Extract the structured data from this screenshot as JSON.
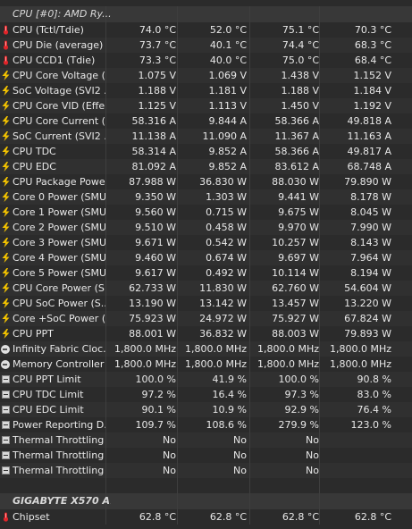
{
  "groups": [
    {
      "title": "CPU [#0]: AMD Ry...",
      "rows": [
        {
          "icon": "thermometer-icon",
          "name": "CPU (Tctl/Tdie)",
          "v": [
            "74.0 °C",
            "52.0 °C",
            "75.1 °C",
            "70.3 °C"
          ]
        },
        {
          "icon": "thermometer-icon",
          "name": "CPU Die (average)",
          "v": [
            "73.7 °C",
            "40.1 °C",
            "74.4 °C",
            "68.3 °C"
          ]
        },
        {
          "icon": "thermometer-icon",
          "name": "CPU CCD1 (Tdie)",
          "v": [
            "73.3 °C",
            "40.0 °C",
            "75.0 °C",
            "68.4 °C"
          ]
        },
        {
          "icon": "lightning-icon",
          "name": "CPU Core Voltage (...",
          "v": [
            "1.075 V",
            "1.069 V",
            "1.438 V",
            "1.152 V"
          ]
        },
        {
          "icon": "lightning-icon",
          "name": "SoC Voltage (SVI2 ...",
          "v": [
            "1.188 V",
            "1.181 V",
            "1.188 V",
            "1.184 V"
          ]
        },
        {
          "icon": "lightning-icon",
          "name": "CPU Core VID (Effe...",
          "v": [
            "1.125 V",
            "1.113 V",
            "1.450 V",
            "1.192 V"
          ]
        },
        {
          "icon": "lightning-icon",
          "name": "CPU Core Current (...",
          "v": [
            "58.316 A",
            "9.844 A",
            "58.366 A",
            "49.818 A"
          ]
        },
        {
          "icon": "lightning-icon",
          "name": "SoC Current (SVI2 ...",
          "v": [
            "11.138 A",
            "11.090 A",
            "11.367 A",
            "11.163 A"
          ]
        },
        {
          "icon": "lightning-icon",
          "name": "CPU TDC",
          "v": [
            "58.314 A",
            "9.852 A",
            "58.366 A",
            "49.817 A"
          ]
        },
        {
          "icon": "lightning-icon",
          "name": "CPU EDC",
          "v": [
            "81.092 A",
            "9.852 A",
            "83.612 A",
            "68.748 A"
          ]
        },
        {
          "icon": "lightning-icon",
          "name": "CPU Package Powe...",
          "v": [
            "87.988 W",
            "36.830 W",
            "88.030 W",
            "79.890 W"
          ]
        },
        {
          "icon": "lightning-icon",
          "name": "Core 0 Power (SMU)",
          "v": [
            "9.350 W",
            "1.303 W",
            "9.441 W",
            "8.178 W"
          ]
        },
        {
          "icon": "lightning-icon",
          "name": "Core 1 Power (SMU)",
          "v": [
            "9.560 W",
            "0.715 W",
            "9.675 W",
            "8.045 W"
          ]
        },
        {
          "icon": "lightning-icon",
          "name": "Core 2 Power (SMU)",
          "v": [
            "9.510 W",
            "0.458 W",
            "9.970 W",
            "7.990 W"
          ]
        },
        {
          "icon": "lightning-icon",
          "name": "Core 3 Power (SMU)",
          "v": [
            "9.671 W",
            "0.542 W",
            "10.257 W",
            "8.143 W"
          ]
        },
        {
          "icon": "lightning-icon",
          "name": "Core 4 Power (SMU)",
          "v": [
            "9.460 W",
            "0.674 W",
            "9.697 W",
            "7.964 W"
          ]
        },
        {
          "icon": "lightning-icon",
          "name": "Core 5 Power (SMU)",
          "v": [
            "9.617 W",
            "0.492 W",
            "10.114 W",
            "8.194 W"
          ]
        },
        {
          "icon": "lightning-icon",
          "name": "CPU Core Power (S...",
          "v": [
            "62.733 W",
            "11.830 W",
            "62.760 W",
            "54.604 W"
          ]
        },
        {
          "icon": "lightning-icon",
          "name": "CPU SoC Power (S...",
          "v": [
            "13.190 W",
            "13.142 W",
            "13.457 W",
            "13.220 W"
          ]
        },
        {
          "icon": "lightning-icon",
          "name": "Core +SoC Power (...",
          "v": [
            "75.923 W",
            "24.972 W",
            "75.927 W",
            "67.824 W"
          ]
        },
        {
          "icon": "lightning-icon",
          "name": "CPU PPT",
          "v": [
            "88.001 W",
            "36.832 W",
            "88.003 W",
            "79.893 W"
          ]
        },
        {
          "icon": "clock-icon",
          "name": "Infinity Fabric Cloc...",
          "v": [
            "1,800.0 MHz",
            "1,800.0 MHz",
            "1,800.0 MHz",
            "1,800.0 MHz"
          ]
        },
        {
          "icon": "clock-icon",
          "name": "Memory Controller ...",
          "v": [
            "1,800.0 MHz",
            "1,800.0 MHz",
            "1,800.0 MHz",
            "1,800.0 MHz"
          ]
        },
        {
          "icon": "expand-icon",
          "name": "CPU PPT Limit",
          "v": [
            "100.0 %",
            "41.9 %",
            "100.0 %",
            "90.8 %"
          ]
        },
        {
          "icon": "expand-icon",
          "name": "CPU TDC Limit",
          "v": [
            "97.2 %",
            "16.4 %",
            "97.3 %",
            "83.0 %"
          ]
        },
        {
          "icon": "expand-icon",
          "name": "CPU EDC Limit",
          "v": [
            "90.1 %",
            "10.9 %",
            "92.9 %",
            "76.4 %"
          ]
        },
        {
          "icon": "expand-icon",
          "name": "Power Reporting D...",
          "v": [
            "109.7 %",
            "108.6 %",
            "279.9 %",
            "123.0 %"
          ]
        },
        {
          "icon": "expand-icon",
          "name": "Thermal Throttling ...",
          "v": [
            "No",
            "No",
            "No",
            ""
          ]
        },
        {
          "icon": "expand-icon",
          "name": "Thermal Throttling ...",
          "v": [
            "No",
            "No",
            "No",
            ""
          ]
        },
        {
          "icon": "expand-icon",
          "name": "Thermal Throttling ...",
          "v": [
            "No",
            "No",
            "No",
            ""
          ]
        }
      ]
    },
    {
      "title": "GIGABYTE X570 A...",
      "rows": [
        {
          "icon": "thermometer-icon",
          "name": "Chipset",
          "v": [
            "62.8 °C",
            "62.8 °C",
            "62.8 °C",
            "62.8 °C"
          ]
        }
      ]
    }
  ],
  "colors": {
    "background": "#2b2b2b",
    "alt_row": "#303030",
    "header_row": "#383838",
    "thermometer_red": "#e0252a",
    "lightning_yellow": "#f2c200"
  }
}
